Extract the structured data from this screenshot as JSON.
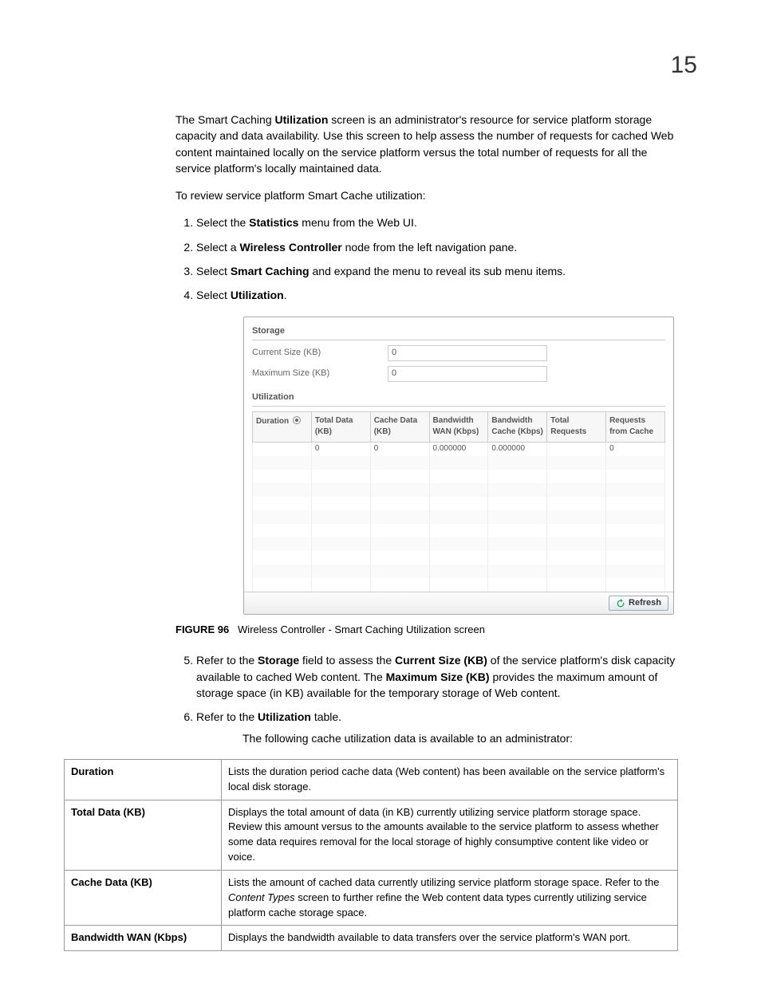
{
  "page_number": "15",
  "intro": {
    "pre": "The Smart Caching ",
    "bold1": "Utilization",
    "post": " screen is an administrator's resource for service platform storage capacity and data availability. Use this screen to help assess the number of requests for cached Web content maintained locally on the service platform versus the total number of requests for all the service platform's locally maintained data."
  },
  "review_line": "To review service platform Smart Cache utilization:",
  "steps": {
    "s1": {
      "pre": "Select the ",
      "bold": "Statistics",
      "post": " menu from the Web UI."
    },
    "s2": {
      "pre": "Select a ",
      "bold": "Wireless Controller",
      "post": " node from the left navigation pane."
    },
    "s3": {
      "pre": "Select ",
      "bold": "Smart Caching",
      "post": " and expand the menu to reveal its sub menu items."
    },
    "s4": {
      "pre": "Select ",
      "bold": "Utilization",
      "post": "."
    }
  },
  "screenshot": {
    "storage": {
      "title": "Storage",
      "current_label": "Current Size (KB)",
      "current_value": "0",
      "max_label": "Maximum Size (KB)",
      "max_value": "0"
    },
    "utilization": {
      "title": "Utilization",
      "headers": [
        "Duration",
        "Total Data (KB)",
        "Cache Data (KB)",
        "Bandwidth WAN (Kbps)",
        "Bandwidth Cache (Kbps)",
        "Total Requests",
        "Requests from Cache"
      ],
      "row0": [
        "",
        "0",
        "0",
        "0.000000",
        "0.000000",
        "",
        "0"
      ]
    },
    "refresh_label": "Refresh"
  },
  "figure": {
    "label": "FIGURE 96",
    "caption": "Wireless Controller - Smart Caching Utilization screen"
  },
  "step5": {
    "pre": "Refer to the ",
    "bold1": "Storage",
    "mid1": " field to assess the ",
    "bold2": "Current Size (KB)",
    "mid2": " of the service platform's disk capacity available to cached Web content. The ",
    "bold3": "Maximum Size (KB)",
    "post": " provides the maximum amount of storage space (in KB) available for the temporary storage of Web content."
  },
  "step6": {
    "pre": "Refer to the ",
    "bold": "Utilization",
    "post": " table."
  },
  "step6_sub": "The following cache utilization data is available to an administrator:",
  "desc_table": [
    {
      "label": "Duration",
      "desc": "Lists the duration period cache data (Web content) has been available on the service platform's local disk storage."
    },
    {
      "label": "Total Data (KB)",
      "desc": "Displays the total amount of data (in KB) currently utilizing service platform storage space. Review this amount versus to the amounts available to the service platform to assess whether some data requires removal for the local storage of highly consumptive content like video or voice."
    },
    {
      "label": "Cache Data (KB)",
      "desc_pre": "Lists the amount of cached data currently utilizing service platform storage space. Refer to the ",
      "desc_italic": "Content Types",
      "desc_post": " screen to further refine the Web content data types currently utilizing service platform cache storage space."
    },
    {
      "label": "Bandwidth WAN (Kbps)",
      "desc": "Displays the bandwidth available to data transfers over the service platform's WAN port."
    }
  ]
}
